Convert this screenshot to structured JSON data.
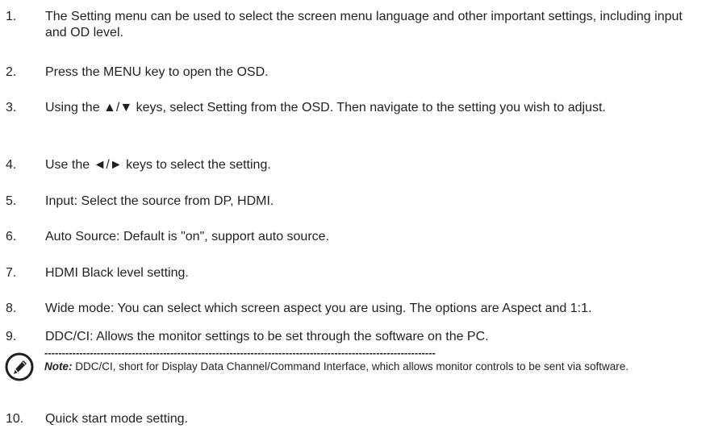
{
  "items": [
    {
      "number": "1.",
      "text": "The Setting menu can be used to select the screen menu language and other important settings, including input and OD level."
    },
    {
      "number": "2.",
      "text": "Press the MENU key to open the OSD."
    },
    {
      "number": "3.",
      "text": "Using the ▲/▼ keys, select Setting from the OSD. Then navigate to the setting you wish to adjust."
    },
    {
      "number": "4.",
      "text": "Use the ◄/► keys to select the setting."
    },
    {
      "number": "5.",
      "text": "Input: Select the source from DP, HDMI."
    },
    {
      "number": "6.",
      "text": "Auto Source: Default is \"on\", support auto source."
    },
    {
      "number": "7.",
      "text": "HDMI Black level setting."
    },
    {
      "number": "8.",
      "text": "Wide mode: You can select which screen aspect you are using. The options are Aspect and 1:1."
    },
    {
      "number": "9.",
      "text": "DDC/CI: Allows the monitor settings to be set through the software on the PC."
    },
    {
      "number": "10.",
      "text": "Quick start mode setting."
    }
  ],
  "note": {
    "icon": "note-pen-icon",
    "rule": "----------------------------------------------------------------------------------------------------------------",
    "label": "Note:",
    "text": " DDC/CI, short for Display Data Channel/Command Interface, which allows monitor controls to be sent via software."
  }
}
